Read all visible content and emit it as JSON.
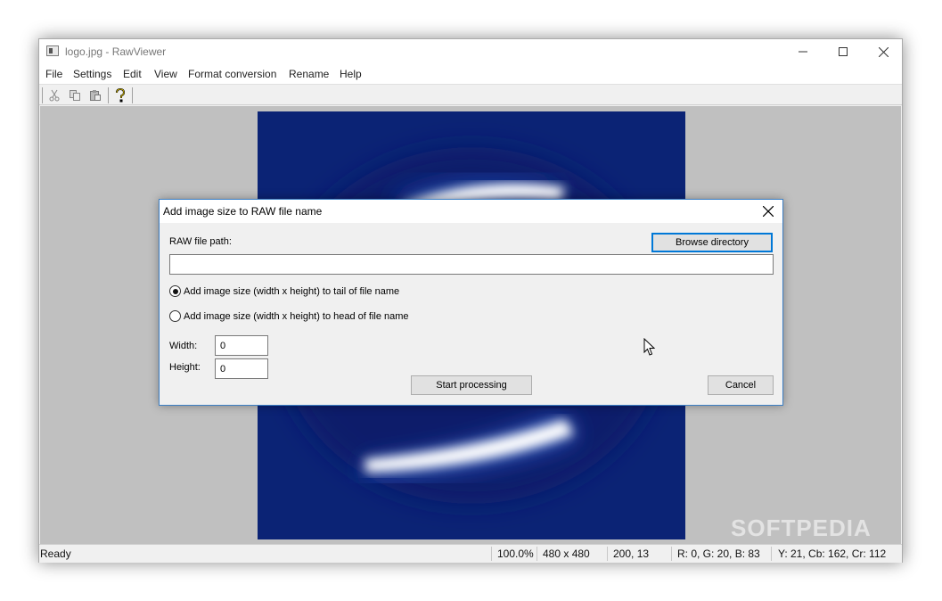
{
  "window": {
    "title": "logo.jpg - RawViewer"
  },
  "menu": [
    "File",
    "Settings",
    "Edit",
    "View",
    "Format conversion",
    "Rename",
    "Help"
  ],
  "toolbar": {
    "icons": [
      "cut-icon",
      "copy-icon",
      "paste-icon",
      "help-icon"
    ]
  },
  "watermark": "SOFTPEDIA",
  "status": {
    "ready": "Ready",
    "zoom": "100.0%",
    "dimensions": "480 x 480",
    "position": "200, 13",
    "rgb": "R: 0, G: 20, B: 83",
    "ycbcr": "Y: 21, Cb: 162, Cr: 112"
  },
  "dialog": {
    "title": "Add image size to RAW file name",
    "raw_path_label": "RAW file path:",
    "raw_path_value": "",
    "browse_label": "Browse directory",
    "option_tail": "Add image size (width x height) to tail of file name",
    "option_head": "Add image size (width x height) to head of file name",
    "selected_option": "tail",
    "width_label": "Width:",
    "width_value": "0",
    "height_label": "Height:",
    "height_value": "0",
    "start_label": "Start processing",
    "cancel_label": "Cancel"
  },
  "colors": {
    "image_background": "#0a2070",
    "dialog_border": "#3c7fc4",
    "focus": "#0078d7"
  }
}
